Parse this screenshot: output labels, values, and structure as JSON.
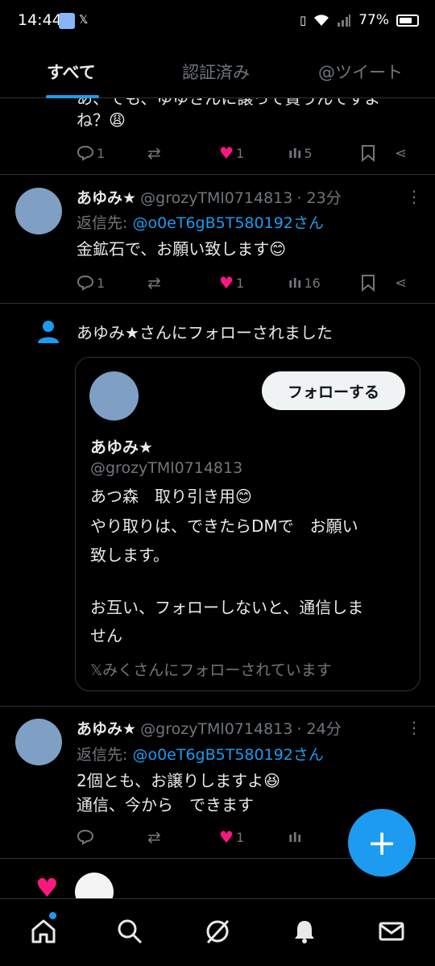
{
  "status": {
    "time": "14:44",
    "battery": "77%"
  },
  "tabs": [
    "すべて",
    "認証済み",
    "@ツイート"
  ],
  "partial_tweet": {
    "line1": "あ、でも、ゆゆさんに譲って貰うんですよ",
    "line2": "ね？😩",
    "replies": "1",
    "likes": "1",
    "views": "5"
  },
  "tweet1": {
    "name": "あゆみ★",
    "handle": "@grozyTMl0714813",
    "time": "· 23分",
    "reply_label": "返信先:",
    "reply_to": "@o0eT6gB5T580192さん",
    "text": "金鉱石で、お願い致します😊",
    "replies": "1",
    "likes": "1",
    "views": "16"
  },
  "follow_notice": {
    "text": "あゆみ★さんにフォローされました",
    "card": {
      "follow_button": "フォローする",
      "name": "あゆみ★",
      "handle": "@grozyTMl0714813",
      "bio_line1": "あつ森　取り引き用😊",
      "bio_line2": "やり取りは、できたらDMで　お願い",
      "bio_line3": "致します。",
      "bio_line4": "お互い、フォローしないと、通信しま",
      "bio_line5": "せん",
      "followed_by": "𝕏みくさんにフォローされています"
    }
  },
  "tweet2": {
    "name": "あゆみ★",
    "handle": "@grozyTMl0714813",
    "time": "· 24分",
    "reply_label": "返信先:",
    "reply_to": "@o0eT6gB5T580192さん",
    "line1": "2個とも、お譲りしますよ😆",
    "line2": "通信、今から　できます",
    "likes": "1"
  },
  "colors": {
    "accent": "#1d9bf0",
    "like": "#f91880",
    "muted": "#71767b"
  }
}
